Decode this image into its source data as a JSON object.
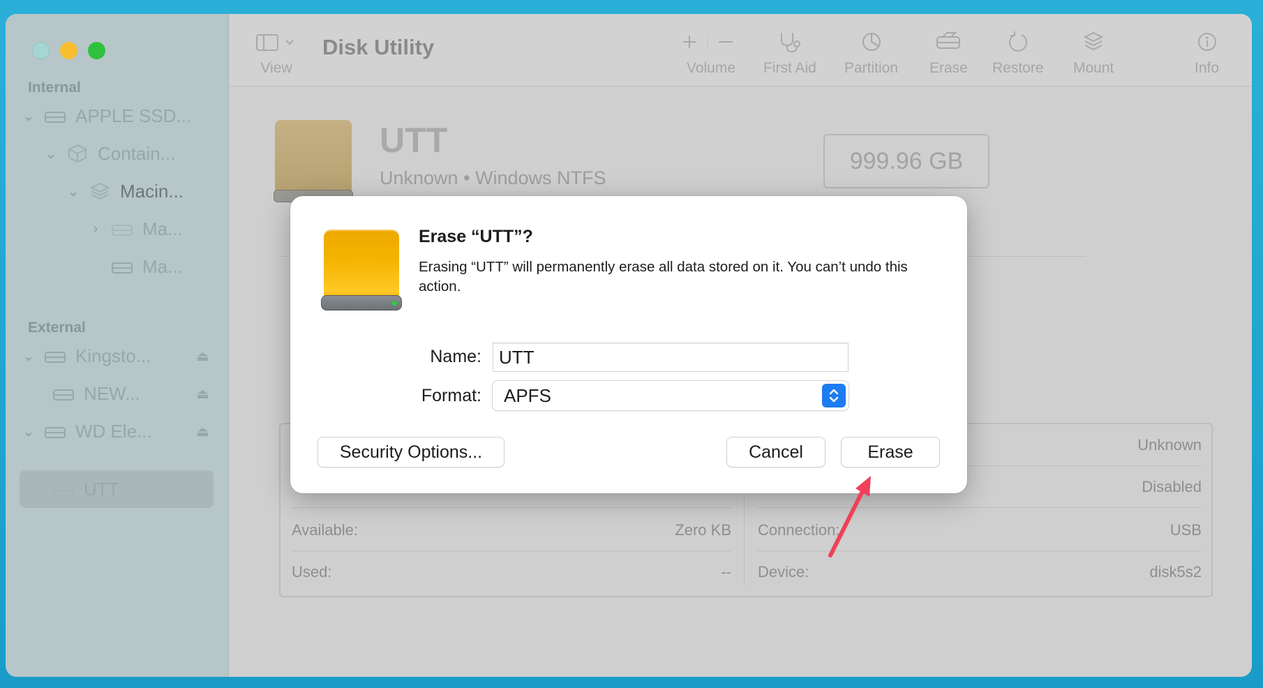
{
  "app": {
    "title": "Disk Utility"
  },
  "window_controls": [
    "close",
    "minimize",
    "zoom"
  ],
  "sidebar": {
    "internal_label": "Internal",
    "external_label": "External",
    "internal_items": [
      {
        "label": "APPLE SSD...",
        "icon": "drive-icon",
        "expanded": true
      },
      {
        "label": "Contain...",
        "icon": "container-icon",
        "expanded": true
      },
      {
        "label": "Macin...",
        "icon": "volume-stack-icon",
        "expanded": true
      },
      {
        "label": "Ma...",
        "icon": "drive-icon",
        "expanded": false
      },
      {
        "label": "Ma...",
        "icon": "drive-icon"
      }
    ],
    "external_items": [
      {
        "label": "Kingsto...",
        "icon": "drive-icon",
        "eject": true
      },
      {
        "label": "NEW...",
        "icon": "drive-icon",
        "eject": true
      },
      {
        "label": "WD Ele...",
        "icon": "drive-icon",
        "eject": true
      },
      {
        "label": "UTT",
        "icon": "drive-icon",
        "selected": true
      }
    ]
  },
  "toolbar": {
    "view_label": "View",
    "volume_label": "Volume",
    "first_aid_label": "First Aid",
    "partition_label": "Partition",
    "erase_label": "Erase",
    "restore_label": "Restore",
    "mount_label": "Mount",
    "info_label": "Info"
  },
  "disk": {
    "name": "UTT",
    "subtitle": "Unknown • Windows NTFS",
    "capacity": "999.96 GB"
  },
  "info_table": {
    "left": [
      {
        "label": "Available:",
        "value": "Zero KB"
      },
      {
        "label": "Used:",
        "value": "--"
      }
    ],
    "right": [
      {
        "label": "",
        "value": "Unknown"
      },
      {
        "label": "",
        "value": "Disabled"
      },
      {
        "label": "Connection:",
        "value": "USB"
      },
      {
        "label": "Device:",
        "value": "disk5s2"
      }
    ]
  },
  "dialog": {
    "title": "Erase “UTT”?",
    "message": "Erasing “UTT” will permanently erase all data stored on it. You can’t undo this action.",
    "name_label": "Name:",
    "name_value": "UTT",
    "format_label": "Format:",
    "format_value": "APFS",
    "security_button": "Security Options...",
    "cancel_button": "Cancel",
    "erase_button": "Erase"
  },
  "colors": {
    "accent_blue": "#1d7cf2",
    "disk_orange": "#f5b400",
    "annotation_red": "#f0405a"
  }
}
